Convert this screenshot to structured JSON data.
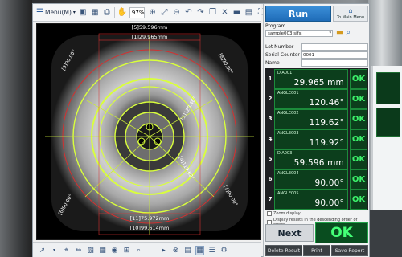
{
  "toolbar": {
    "menu_label": "Menu(M)",
    "zoom_value": "97%"
  },
  "viewport": {
    "dims": [
      {
        "index": "[5]",
        "value": "59.596mm"
      },
      {
        "index": "[1]",
        "value": "29.965mm"
      },
      {
        "index": "[11]",
        "value": "75.972mm"
      },
      {
        "index": "[10]",
        "value": "99.614mm"
      }
    ],
    "angles": [
      {
        "index": "[9]",
        "value": "90.00°"
      },
      {
        "index": "[8]",
        "value": "90.00°"
      },
      {
        "index": "[3]",
        "value": "120.46°"
      },
      {
        "index": "[4]",
        "value": "119.62°"
      },
      {
        "index": "[6]",
        "value": "90.00°"
      },
      {
        "index": "[7]",
        "value": "90.00°"
      }
    ]
  },
  "panel": {
    "run_label": "Run",
    "main_menu_label": "To Main Menu",
    "program_label": "Program",
    "program_value": "sample003.sifs",
    "lot_number_label": "Lot Number",
    "lot_number_value": "",
    "serial_counter_label": "Serial Counter",
    "serial_counter_value": "0001",
    "name_label": "Name",
    "name_value": ""
  },
  "results": [
    {
      "num": "1",
      "name": "DIA001",
      "value": "29.965 mm",
      "status": "OK"
    },
    {
      "num": "2",
      "name": "ANGLE001",
      "value": "120.46°",
      "status": "OK"
    },
    {
      "num": "3",
      "name": "ANGLE002",
      "value": "119.62°",
      "status": "OK"
    },
    {
      "num": "4",
      "name": "ANGLE003",
      "value": "119.92°",
      "status": "OK"
    },
    {
      "num": "5",
      "name": "DIA003",
      "value": "59.596 mm",
      "status": "OK"
    },
    {
      "num": "6",
      "name": "ANGLE004",
      "value": "90.00°",
      "status": "OK"
    },
    {
      "num": "7",
      "name": "ANGLE005",
      "value": "90.00°",
      "status": "OK"
    }
  ],
  "options": {
    "zoom_display": "Zoom display",
    "descending": "Display results in the descending order of errors"
  },
  "actions": {
    "next": "Next",
    "big_status": "OK",
    "delete_result": "Delete Result",
    "print": "Print",
    "save_report": "Save Report"
  },
  "colors": {
    "accent_blue": "#2a7ccb",
    "ok_green": "#3cf06a",
    "result_bg": "#0c3e1c",
    "overlay_yellow": "#d9ff3b",
    "overlay_red": "#e53b3b"
  }
}
